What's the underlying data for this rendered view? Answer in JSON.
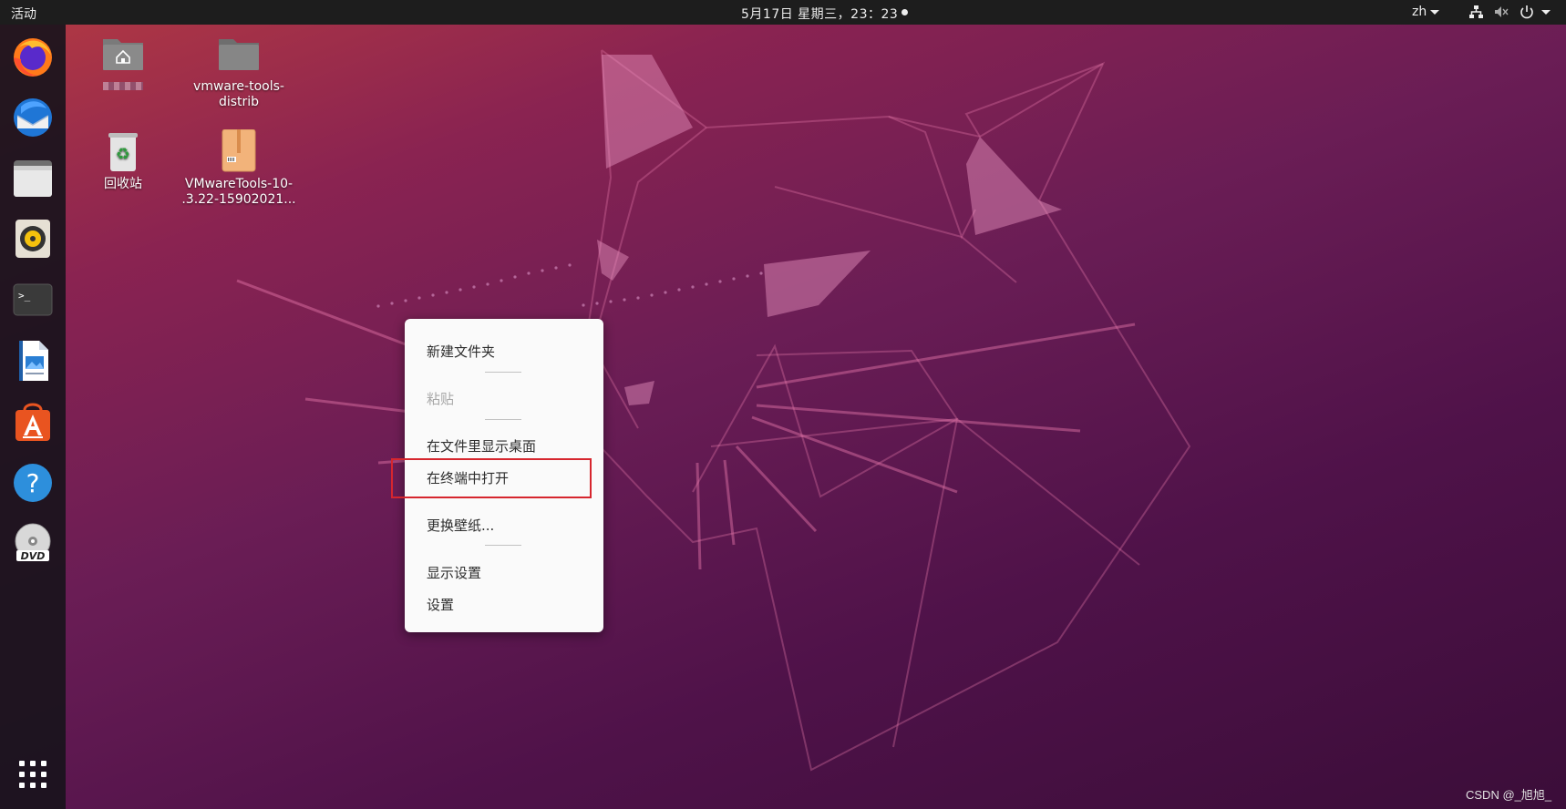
{
  "topbar": {
    "activities": "活动",
    "clock": "5月17日 星期三，23：23",
    "language": "zh"
  },
  "dock": {
    "apps": [
      {
        "icon": "firefox-icon"
      },
      {
        "icon": "thunderbird-icon"
      },
      {
        "icon": "files-icon"
      },
      {
        "icon": "rhythmbox-icon"
      },
      {
        "icon": "terminal-icon"
      },
      {
        "icon": "writer-icon"
      },
      {
        "icon": "software-icon"
      },
      {
        "icon": "help-icon"
      },
      {
        "icon": "dvd-icon"
      },
      {
        "icon": "show-apps-icon"
      }
    ],
    "terminal_prompt": ">_"
  },
  "desktop": {
    "icons": [
      {
        "label": "",
        "icon": "home-folder-icon"
      },
      {
        "label_line1": "vmware-tools-",
        "label_line2": "distrib",
        "icon": "folder-icon"
      },
      {
        "label": "回收站",
        "icon": "trash-icon"
      },
      {
        "label_line1": "VMwareTools-10-",
        "label_line2": ".3.22-15902021...",
        "icon": "archive-icon"
      }
    ]
  },
  "context_menu": {
    "new_folder": "新建文件夹",
    "paste": "粘贴",
    "show_in_files": "在文件里显示桌面",
    "open_terminal": "在终端中打开",
    "change_background": "更换壁纸...",
    "display_settings": "显示设置",
    "settings": "设置"
  },
  "watermark": "CSDN @_旭旭_",
  "colors": {
    "topbar": "#1d1d1d",
    "highlight_box": "#d6262e",
    "menu_bg": "#fafafa"
  }
}
